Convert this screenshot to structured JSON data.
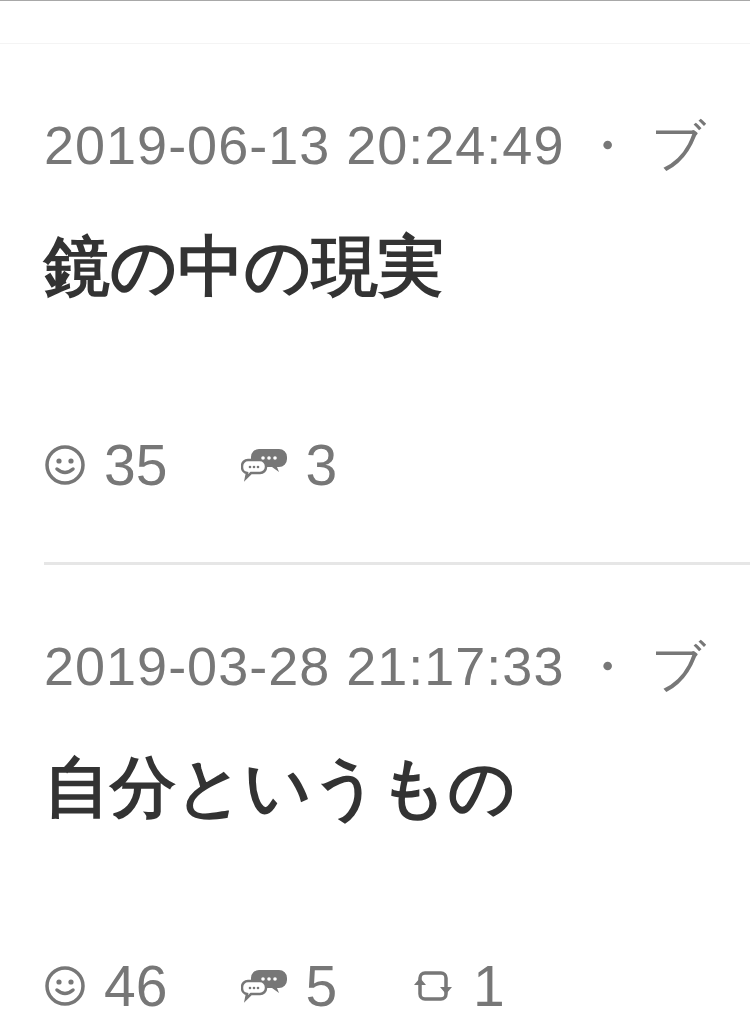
{
  "posts": [
    {
      "meta": "2019-06-13 20:24:49 ・ ブ",
      "title": "鏡の中の現実",
      "stats": [
        {
          "kind": "smile",
          "count": "35"
        },
        {
          "kind": "comment",
          "count": "3"
        }
      ]
    },
    {
      "meta": "2019-03-28 21:17:33 ・ ブ",
      "title": "自分というもの",
      "stats": [
        {
          "kind": "smile",
          "count": "46"
        },
        {
          "kind": "comment",
          "count": "5"
        },
        {
          "kind": "repost",
          "count": "1"
        }
      ]
    }
  ]
}
